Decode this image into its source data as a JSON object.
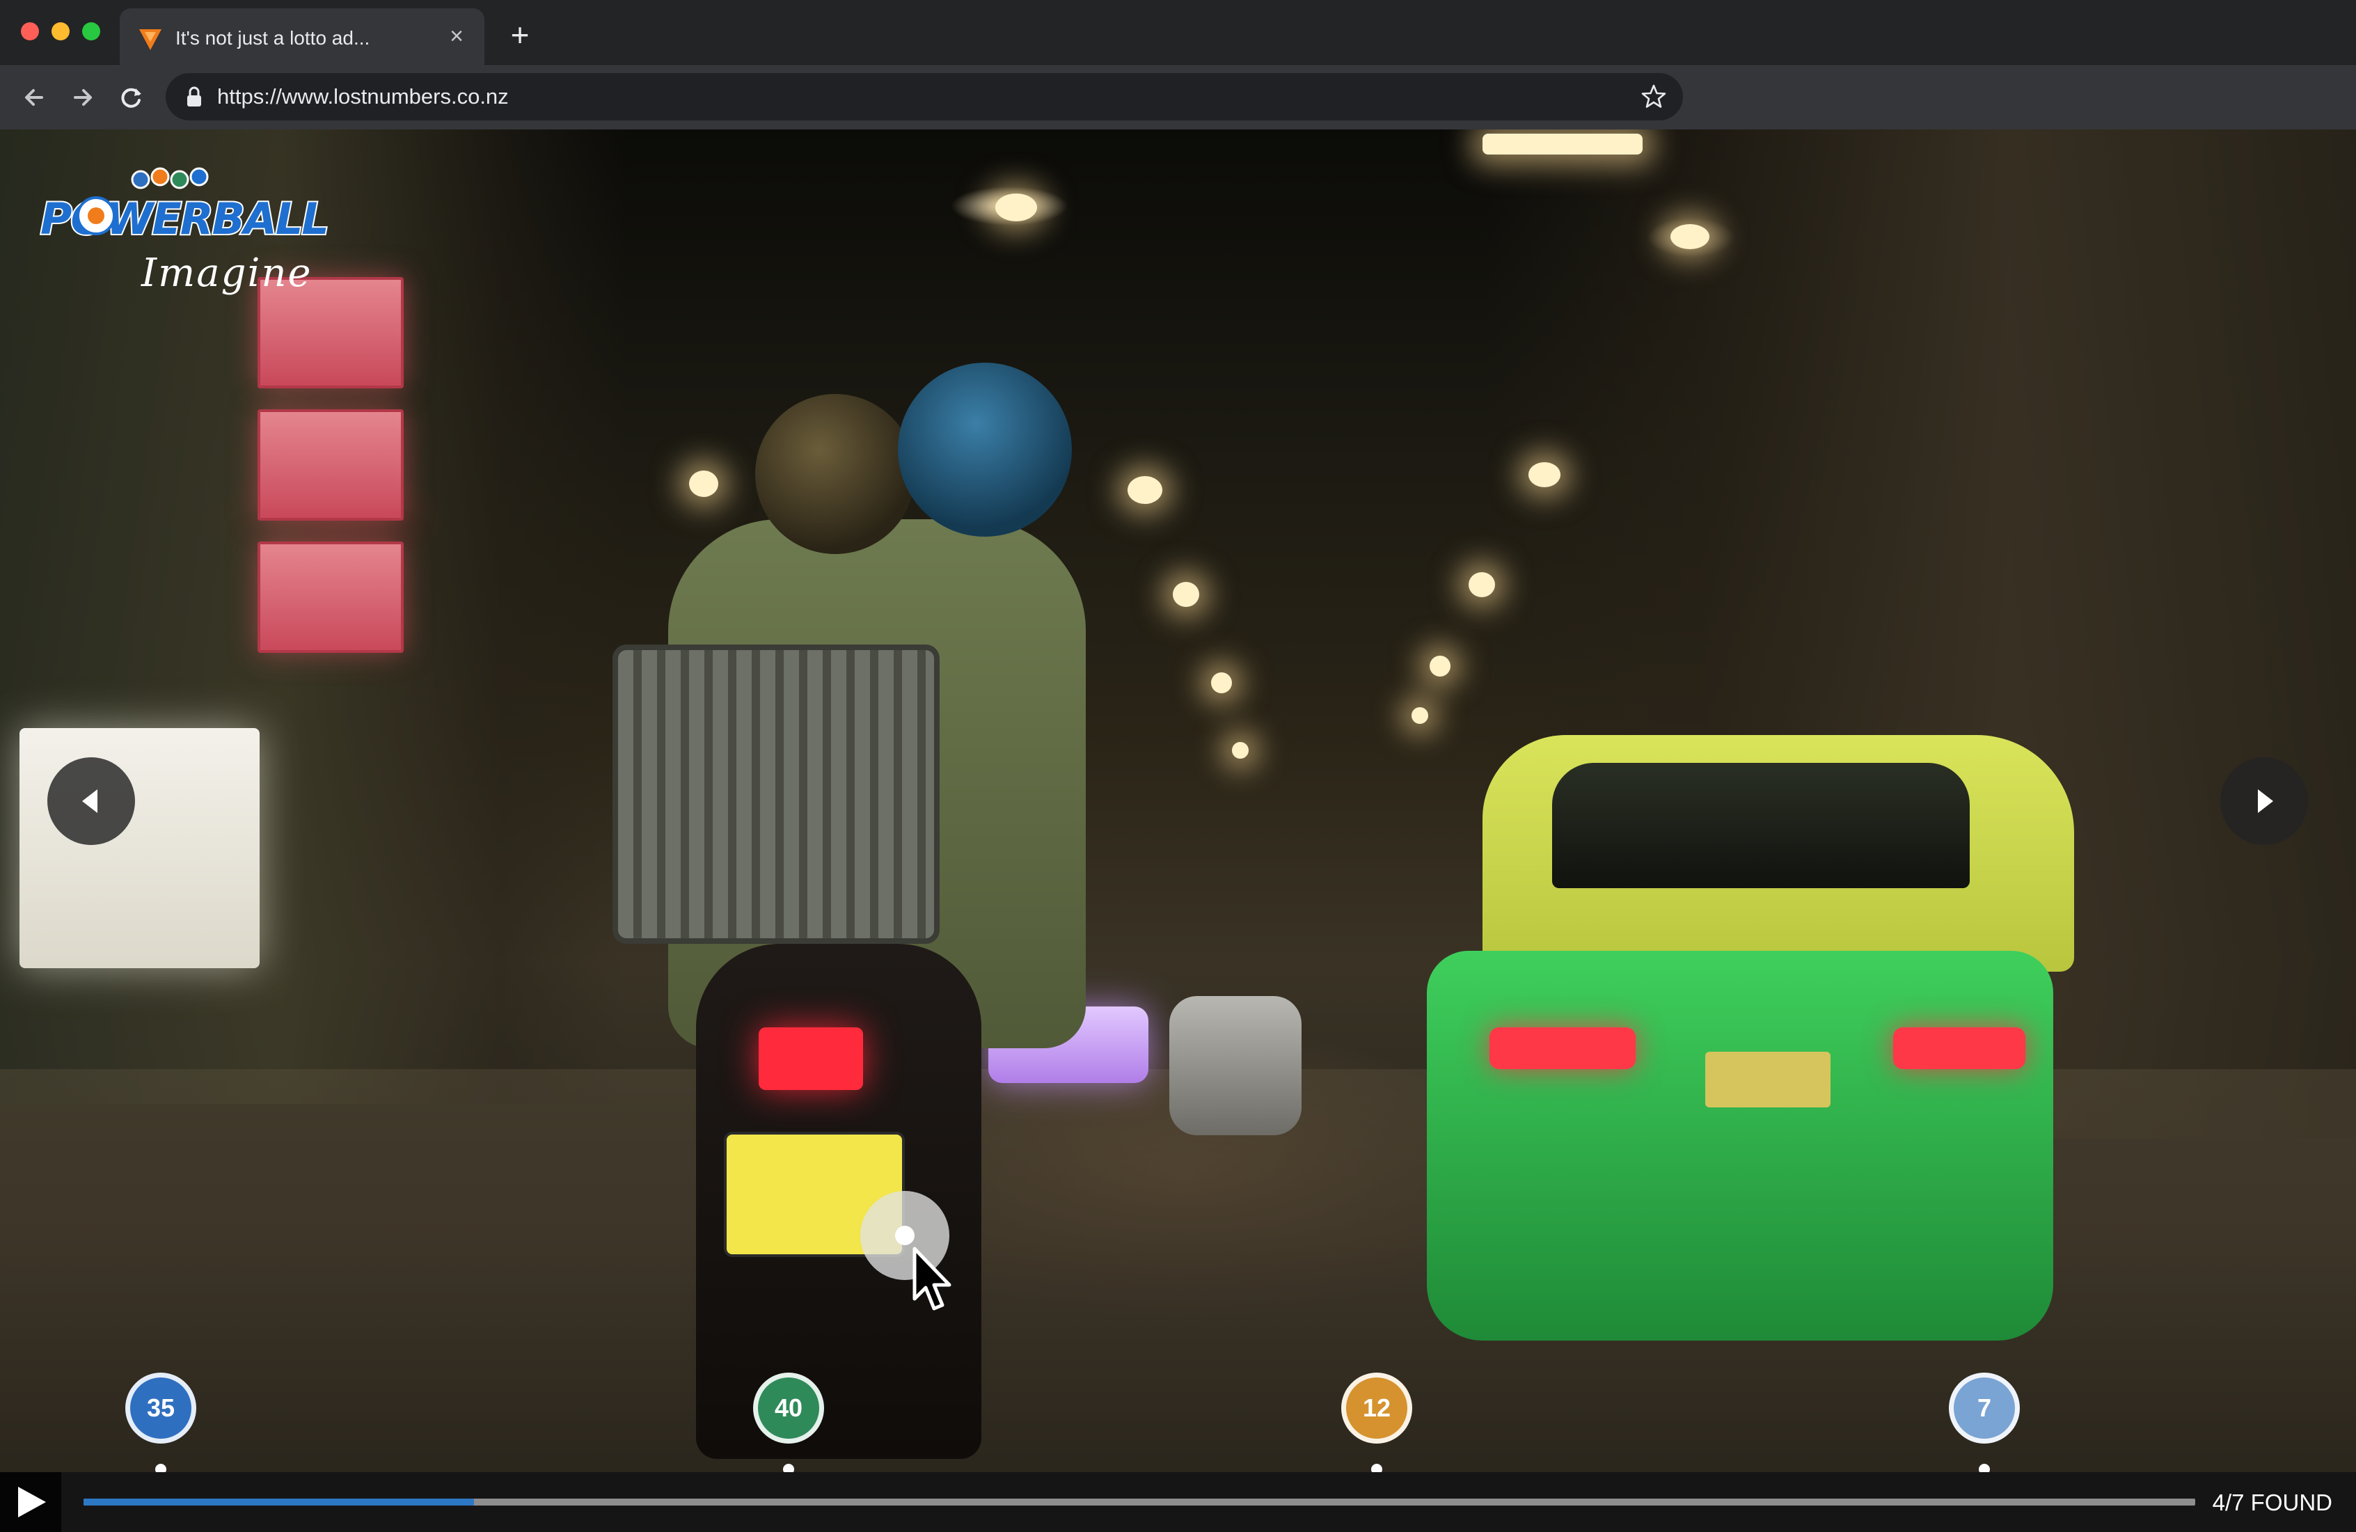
{
  "browser": {
    "tab": {
      "title": "It's not just a lotto ad...",
      "favicon": "powerball-triangle-icon"
    },
    "address": {
      "url": "https://www.lostnumbers.co.nz"
    },
    "icons": [
      "back-arrow-icon",
      "forward-arrow-icon",
      "reload-icon",
      "lock-icon",
      "star-icon",
      "close-icon",
      "plus-icon"
    ]
  },
  "page": {
    "logo": {
      "brand": "POWERBALL",
      "tagline": "Imagine"
    },
    "markers": [
      {
        "number": "35",
        "color": "#2f6fc0"
      },
      {
        "number": "40",
        "color": "#2f8a5a"
      },
      {
        "number": "12",
        "color": "#d6922e"
      },
      {
        "number": "7",
        "color": "#7aa4d4"
      }
    ],
    "player": {
      "progress": 0.185,
      "found_label": "4/7 FOUND"
    }
  },
  "colors": {
    "accent": "#2d78c4",
    "chrome_dark": "#232426",
    "chrome_toolbar": "#35363a"
  }
}
